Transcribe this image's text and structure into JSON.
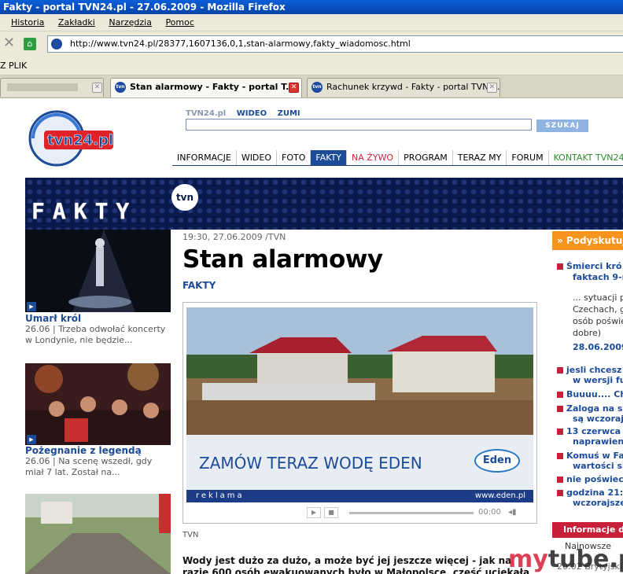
{
  "window": {
    "title": "Fakty - portal TVN24.pl - 27.06.2009 - Mozilla Firefox"
  },
  "menu": [
    "Historia",
    "Zakładki",
    "Narzędzia",
    "Pomoc"
  ],
  "urlbar": {
    "url": "http://www.tvn24.pl/28377,1607136,0,1,stan-alarmowy,fakty_wiadomosc.html"
  },
  "bookmarks": {
    "label": "Z PLIK"
  },
  "tabs": [
    {
      "label": "Stan alarmowy - Fakty - portal T..."
    },
    {
      "label": "Rachunek krzywd - Fakty - portal TVN2..."
    }
  ],
  "site": {
    "logo": "tvn24.pl",
    "toplinks": [
      "TVN24.pl",
      "WIDEO",
      "ZUMI"
    ],
    "search_button": "SZUKAJ",
    "nav": [
      "INFORMACJE",
      "WIDEO",
      "FOTO",
      "FAKTY",
      "NA ŻYWO",
      "PROGRAM",
      "TERAZ MY",
      "FORUM",
      "KONTAKT TVN24"
    ],
    "banner": {
      "fakty": "FAKTY",
      "tvn": "tvn"
    }
  },
  "left": [
    {
      "title": "Umarł król",
      "date": "26.06",
      "text": "Trzeba odwołać koncerty w Londynie, nie będzie..."
    },
    {
      "title": "Pożegnanie z legendą",
      "date": "26.06",
      "text": "Na scenę wszedł, gdy miał 7 lat. Został na..."
    }
  ],
  "article": {
    "meta": "19:30, 27.06.2009 /TVN",
    "headline": "Stan alarmowy",
    "section": "FAKTY",
    "ad_headline": "ZAMÓW TERAZ WODĘ EDEN",
    "ad_brand": "Eden",
    "ad_label": "reklama",
    "ad_url": "www.eden.pl",
    "time": "00:00",
    "source": "TVN",
    "lead": "Wody jest dużo za dużo, a może być jej jeszcze więcej - jak na razie 600 osób ewakuowanych było w Małopolsce, część uciekała w łodziach w"
  },
  "right": {
    "header": "» Podyskutuj",
    "first_title": "Śmierci kró",
    "first_title2": "faktach 9-n",
    "excerpt": [
      "... sytuacji p",
      "Czechach, g",
      "osób poświę",
      "dobre)"
    ],
    "date": "28.06.2009",
    "items": [
      [
        "jesli chcesz",
        "w wersji full"
      ],
      [
        "Buuuu.... Ch"
      ],
      [
        "Zaloga na s",
        "są wczorajs"
      ],
      [
        "13 czerwca",
        "naprawienia"
      ],
      [
        "Komuś w Fa",
        "wartości się"
      ],
      [
        "nie poświec"
      ],
      [
        "godzina 21:",
        "wczorajsze"
      ]
    ],
    "info_header": "Informacje d",
    "najnowsze": "Najnowsze",
    "godz": "20:02 Brytyjski b"
  },
  "watermark": {
    "a": "my",
    "b": "tube.pl"
  },
  "colors": {
    "brand_blue": "#1c4b98",
    "accent_red": "#c8203a",
    "orange": "#f7941d",
    "banner_navy": "#0b1a4c"
  }
}
